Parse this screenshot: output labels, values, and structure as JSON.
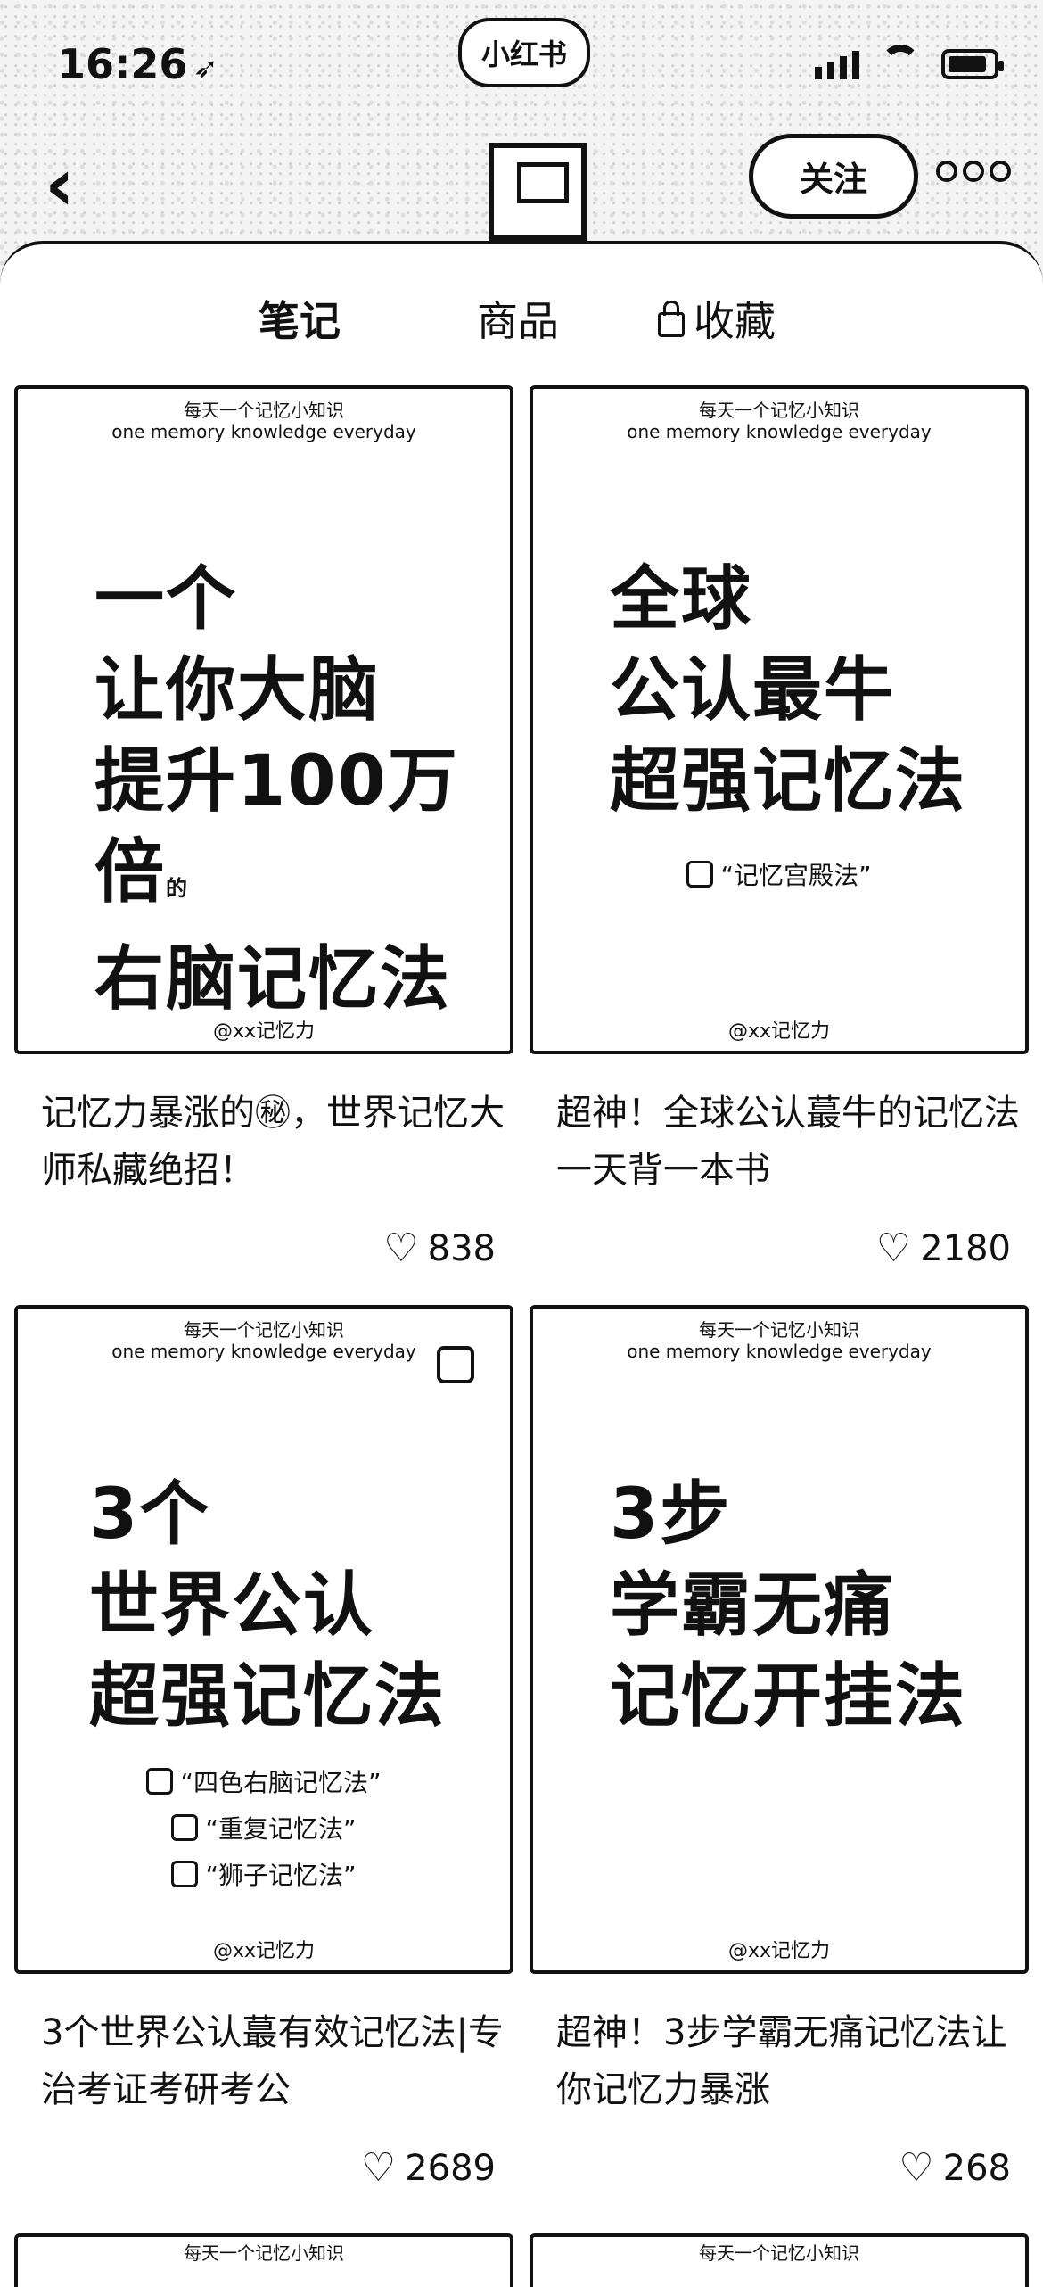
{
  "status_bar": {
    "time": "16:26",
    "app_badge": "小红书"
  },
  "header": {
    "follow_label": "关注"
  },
  "tabs": [
    {
      "label": "笔记",
      "active": true
    },
    {
      "label": "商品",
      "active": false
    },
    {
      "label": "收藏",
      "locked": true,
      "active": false
    }
  ],
  "notes": [
    {
      "cover_top": "每天一个记忆小知识",
      "cover_top_en": "one memory knowledge everyday",
      "cover_lines": [
        "一个",
        "让你大脑",
        "提升100万倍",
        "右脑记忆法"
      ],
      "cover_tiny": "的",
      "cover_footer": "@xx记忆力",
      "title": "记忆力暴涨的㊙，世界记忆大师私藏绝招！",
      "likes": "838"
    },
    {
      "cover_top": "每天一个记忆小知识",
      "cover_top_en": "one memory knowledge everyday",
      "cover_lines": [
        "全球",
        "公认最牛",
        "超强记忆法"
      ],
      "cover_checks": [
        "“记忆宫殿法”"
      ],
      "cover_footer": "@xx记忆力",
      "title": "超神！全球公认蕞牛的记忆法一天背一本书",
      "likes": "2180"
    },
    {
      "cover_top": "每天一个记忆小知识",
      "cover_top_en": "one memory knowledge everyday",
      "cover_lines": [
        "3个",
        "世界公认",
        "超强记忆法"
      ],
      "cover_checks": [
        "“四色右脑记忆法”",
        "“重复记忆法”",
        "“狮子记忆法”"
      ],
      "cover_footer": "@xx记忆力",
      "title": "3个世界公认蕞有效记忆法|专治考证考研考公",
      "likes": "2689"
    },
    {
      "cover_top": "每天一个记忆小知识",
      "cover_top_en": "one memory knowledge everyday",
      "cover_lines": [
        "3步",
        "学霸无痛",
        "记忆开挂法"
      ],
      "cover_footer": "@xx记忆力",
      "title": "超神！3步学霸无痛记忆法让你记忆力暴涨",
      "likes": "268"
    }
  ],
  "partial_cover_top": "每天一个记忆小知识"
}
